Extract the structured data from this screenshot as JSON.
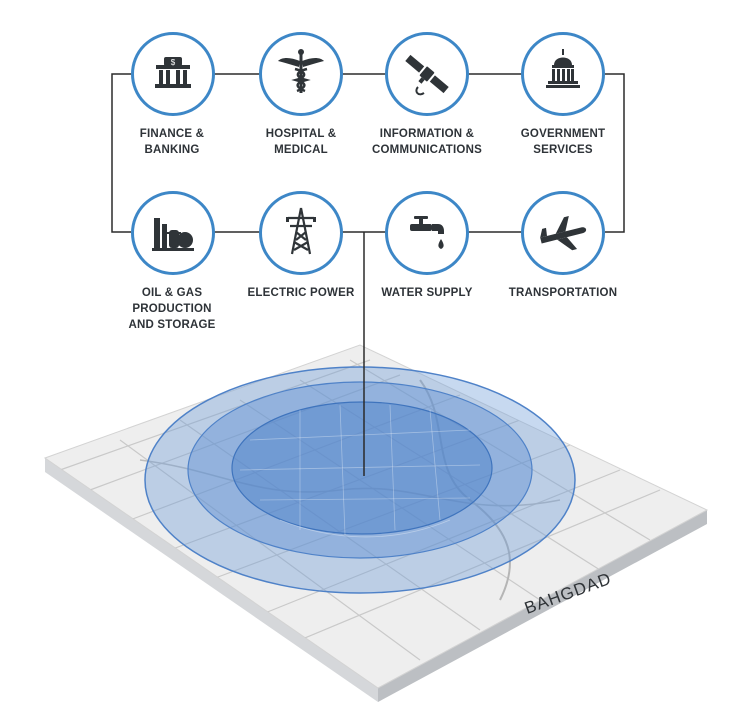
{
  "sectors": [
    {
      "id": "finance",
      "label": "FINANCE &\nBANKING",
      "icon": "bank-icon"
    },
    {
      "id": "hospital",
      "label": "HOSPITAL &\nMEDICAL",
      "icon": "caduceus-icon"
    },
    {
      "id": "information",
      "label": "INFORMATION &\nCOMMUNICATIONS",
      "icon": "satellite-icon"
    },
    {
      "id": "government",
      "label": "GOVERNMENT\nSERVICES",
      "icon": "capitol-icon"
    },
    {
      "id": "oilgas",
      "label": "OIL & GAS\nPRODUCTION\nAND STORAGE",
      "icon": "refinery-icon"
    },
    {
      "id": "electric",
      "label": "ELECTRIC POWER",
      "icon": "power-tower-icon"
    },
    {
      "id": "water",
      "label": "WATER SUPPLY",
      "icon": "faucet-icon"
    },
    {
      "id": "transport",
      "label": "TRANSPORTATION",
      "icon": "airplane-icon"
    }
  ],
  "map": {
    "city": "BAHGDAD"
  },
  "colors": {
    "ring": "#3d87c7",
    "line": "#2b2b2b",
    "icon": "#2f3438",
    "zone": "#4f82c8"
  }
}
